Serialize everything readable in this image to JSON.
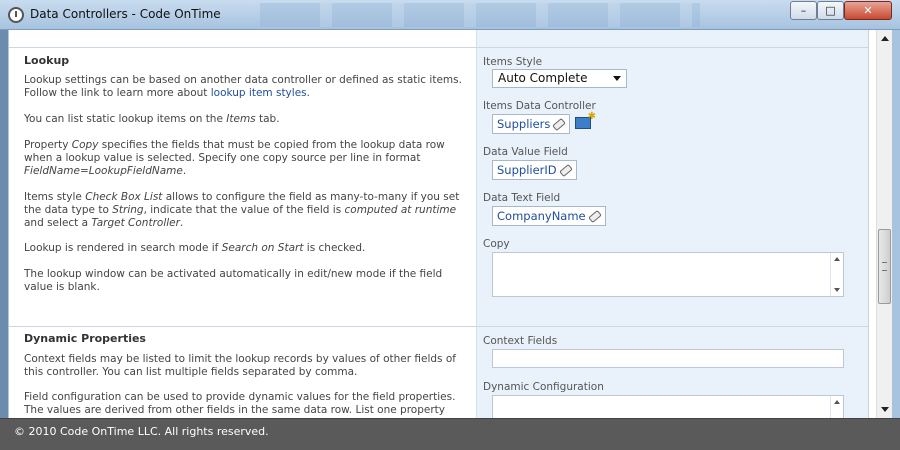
{
  "window": {
    "title": "Data Controllers - Code OnTime",
    "minimize": "–",
    "maximize": "□",
    "close": "✕"
  },
  "lookup_section": {
    "title": "Lookup",
    "p1_pre": "Lookup settings can be based on another data controller or defined as static items. Follow the link to learn more about ",
    "p1_link": "lookup item styles",
    "p1_post": ".",
    "p2_pre": "You can list static lookup items on the ",
    "p2_em": "Items",
    "p2_post": " tab.",
    "p3_a": "Property ",
    "p3_em1": "Copy",
    "p3_b": " specifies the fields that must be copied from the lookup data row when a lookup value is selected. Specify one copy source per line in format ",
    "p3_em2": "FieldName=LookupFieldName",
    "p3_c": ".",
    "p4_a": "Items style ",
    "p4_em1": "Check Box List",
    "p4_b": " allows to configure the field as many-to-many if you set the data type to ",
    "p4_em2": "String",
    "p4_c": ", indicate that the value of the field is ",
    "p4_em3": "computed at runtime",
    "p4_d": " and select a ",
    "p4_em4": "Target Controller",
    "p4_e": ".",
    "p5_a": "Lookup is rendered in search mode if ",
    "p5_em": "Search on Start",
    "p5_b": " is checked.",
    "p6": "The lookup window can be activated automatically in edit/new mode if the field value is blank."
  },
  "lookup_fields": {
    "items_style_label": "Items Style",
    "items_style_value": "Auto Complete",
    "items_data_controller_label": "Items Data Controller",
    "items_data_controller_value": "Suppliers",
    "data_value_field_label": "Data Value Field",
    "data_value_field_value": "SupplierID",
    "data_text_field_label": "Data Text Field",
    "data_text_field_value": "CompanyName",
    "copy_label": "Copy",
    "copy_value": ""
  },
  "dynamic_section": {
    "title": "Dynamic Properties",
    "p1": "Context fields may be listed to limit the lookup records by values of other fields of this controller. You can list multiple fields separated by comma.",
    "p2": "Field configuration can be used to provide dynamic values for the field properties. The values are derived from other fields in the same data row. List one property per line in"
  },
  "dynamic_fields": {
    "context_fields_label": "Context Fields",
    "context_fields_value": "",
    "dynamic_configuration_label": "Dynamic Configuration",
    "dynamic_configuration_value": ""
  },
  "footer": {
    "copyright": "© 2010 Code OnTime LLC. All rights reserved."
  }
}
